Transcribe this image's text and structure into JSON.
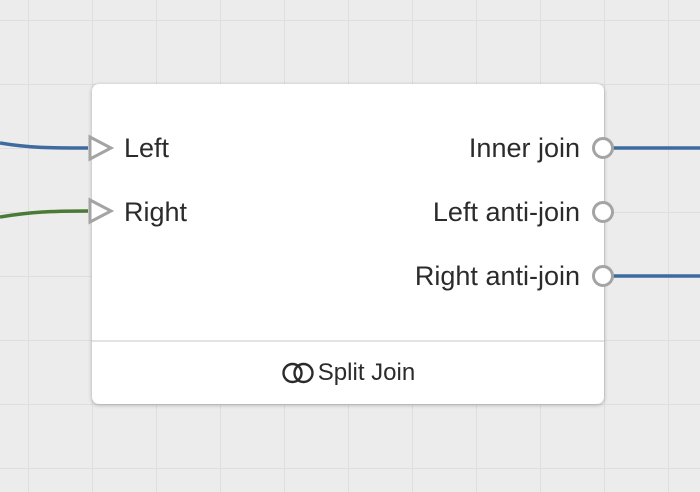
{
  "node": {
    "title": "Split Join",
    "title_icon": "venn-join-icon",
    "inputs": [
      {
        "label": "Left",
        "connected": true,
        "wire_color": "#3e6a9f"
      },
      {
        "label": "Right",
        "connected": true,
        "wire_color": "#4a7a35"
      }
    ],
    "outputs": [
      {
        "label": "Inner join",
        "connected": true,
        "wire_color": "#3e6a9f"
      },
      {
        "label": "Left anti-join",
        "connected": false
      },
      {
        "label": "Right anti-join",
        "connected": true,
        "wire_color": "#3e6a9f"
      }
    ]
  },
  "colors": {
    "canvas_background": "#ececec",
    "grid_line": "#dedede",
    "node_background": "#ffffff",
    "port_outline": "#a4a4a4",
    "text": "#2b2b2b"
  }
}
